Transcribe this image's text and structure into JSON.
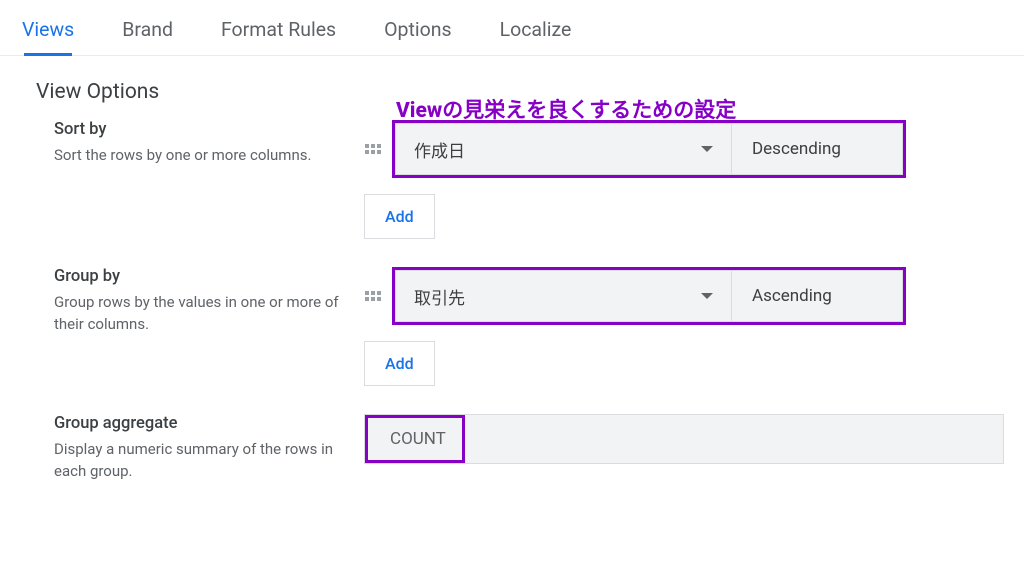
{
  "tabs": {
    "views": "Views",
    "brand": "Brand",
    "format_rules": "Format Rules",
    "options": "Options",
    "localize": "Localize"
  },
  "section": {
    "title": "View Options"
  },
  "annotation": "Viewの見栄えを良くするための設定",
  "sort_by": {
    "title": "Sort by",
    "desc": "Sort the rows by one or more columns.",
    "field": "作成日",
    "order": "Descending",
    "add": "Add"
  },
  "group_by": {
    "title": "Group by",
    "desc": "Group rows by the values in one or more of their columns.",
    "field": "取引先",
    "order": "Ascending",
    "add": "Add"
  },
  "group_agg": {
    "title": "Group aggregate",
    "desc": "Display a numeric summary of the rows in each group.",
    "value": "COUNT"
  }
}
